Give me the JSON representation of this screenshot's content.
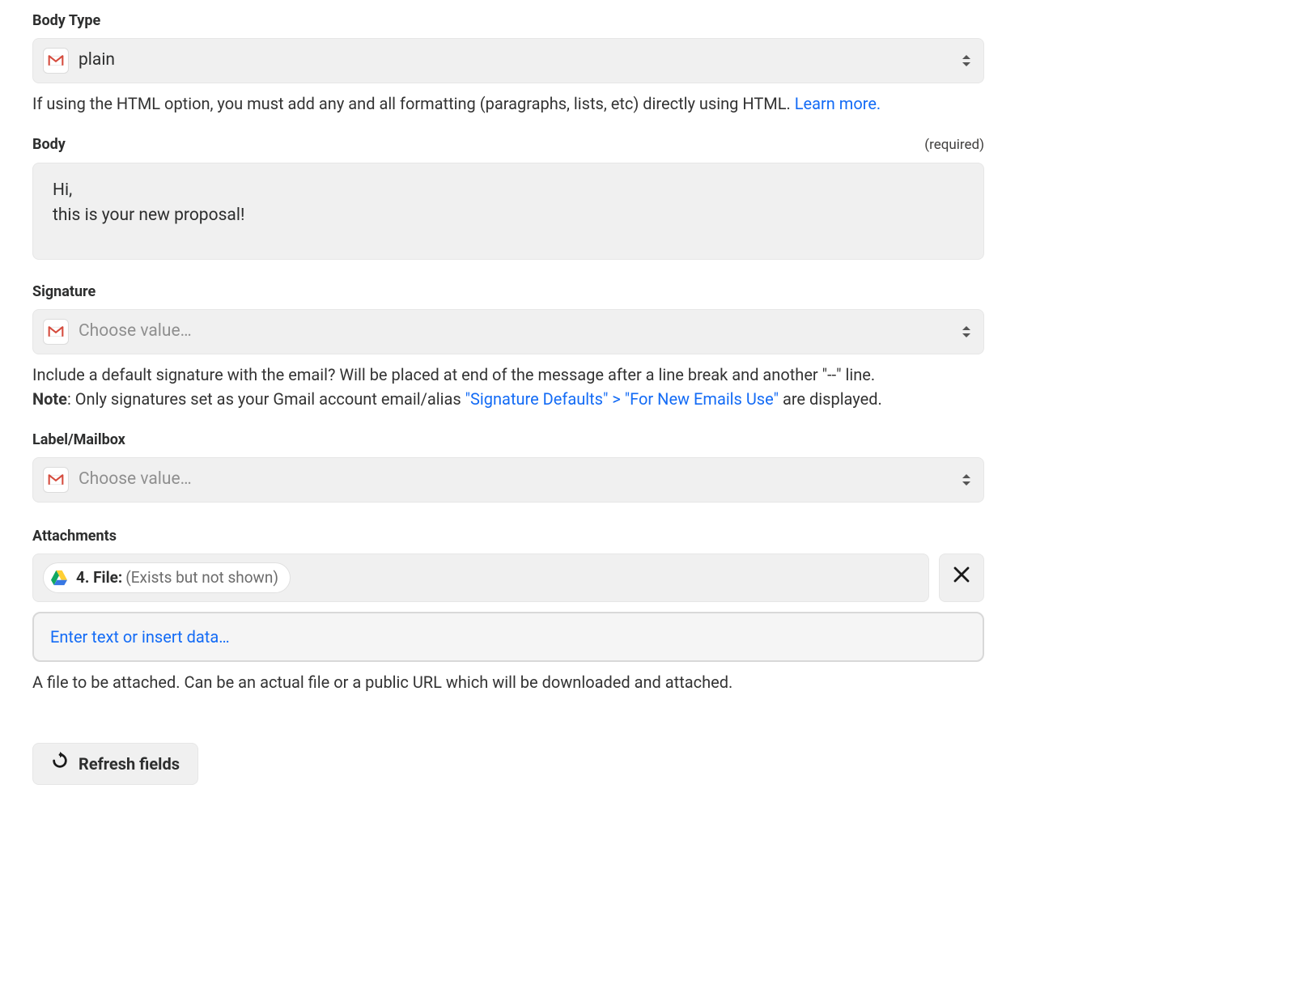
{
  "bodyType": {
    "label": "Body Type",
    "value": "plain",
    "help_prefix": "If using the HTML option, you must add any and all formatting (paragraphs, lists, etc) directly using HTML. ",
    "learn_more": "Learn more."
  },
  "body": {
    "label": "Body",
    "required": "(required)",
    "value": "Hi,\nthis is your new proposal!"
  },
  "signature": {
    "label": "Signature",
    "placeholder": "Choose value…",
    "help_line1": "Include a default signature with the email? Will be placed at end of the message after a line break and another \"--\" line.",
    "note_label": "Note",
    "help_line2_before": ": Only signatures set as your Gmail account email/alias ",
    "help_link": "\"Signature Defaults\" > \"For New Emails Use\"",
    "help_line2_after": " are displayed."
  },
  "labelMailbox": {
    "label": "Label/Mailbox",
    "placeholder": "Choose value…"
  },
  "attachments": {
    "label": "Attachments",
    "pill_step": "4. File: ",
    "pill_status": "(Exists but not shown)",
    "add_text": "Enter text or insert data…",
    "help": "A file to be attached. Can be an actual file or a public URL which will be downloaded and attached."
  },
  "refresh": {
    "label": "Refresh fields"
  }
}
